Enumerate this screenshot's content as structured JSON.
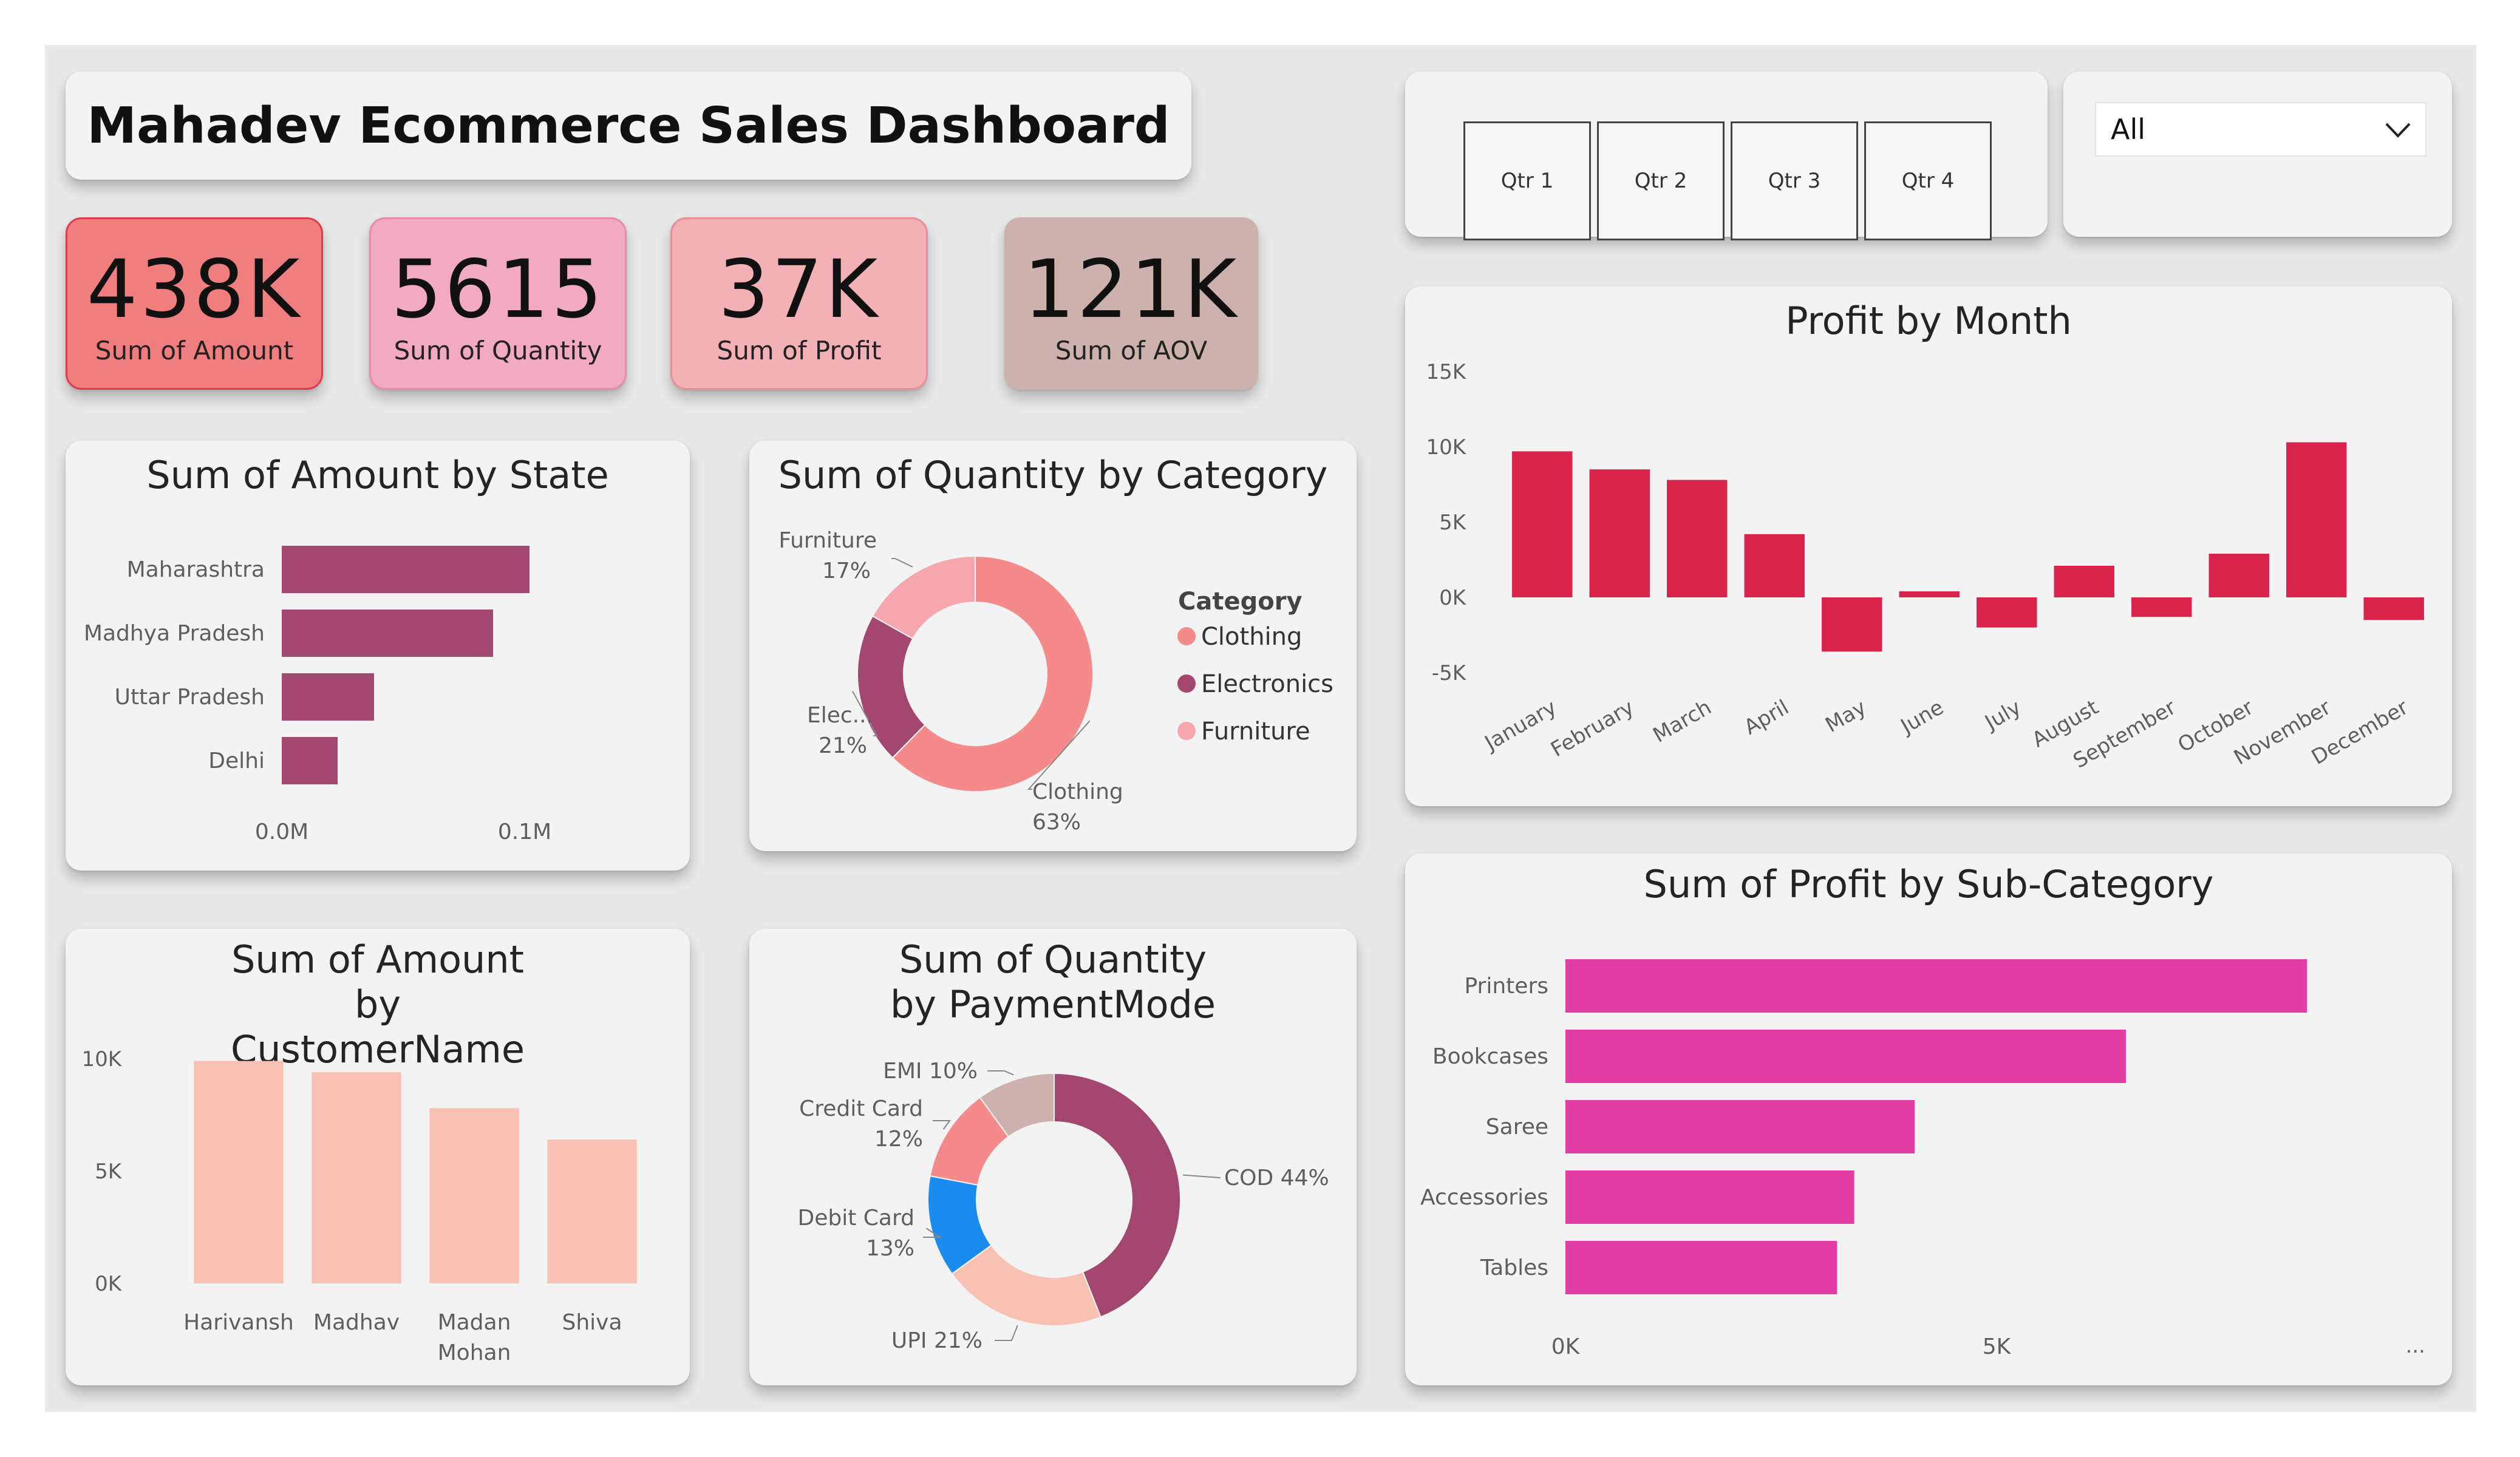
{
  "dashboard_title": "Mahadev Ecommerce Sales Dashboard",
  "kpis": [
    {
      "value": "438K",
      "label": "Sum of Amount",
      "color": "#f07e7e",
      "border": "#e03a4a"
    },
    {
      "value": "5615",
      "label": "Sum of Quantity",
      "color": "#f2a9c2",
      "border": "#e88aa8"
    },
    {
      "value": "37K",
      "label": "Sum of Profit",
      "color": "#f1b1b5",
      "border": "#ea8e95"
    },
    {
      "value": "121K",
      "label": "Sum of AOV",
      "color": "#ccb1ad",
      "border": "#ccb1ad"
    }
  ],
  "quarter_slicer": {
    "items": [
      "Qtr 1",
      "Qtr 2",
      "Qtr 3",
      "Qtr 4"
    ]
  },
  "dropdown_slicer": {
    "value": "All",
    "icon": "chevron-down-icon"
  },
  "chart_data": [
    {
      "id": "amount_by_state",
      "type": "bar",
      "orientation": "horizontal",
      "title": "Sum of Amount by State",
      "categories": [
        "Maharashtra",
        "Madhya Pradesh",
        "Uttar Pradesh",
        "Delhi"
      ],
      "values": [
        102000,
        87000,
        38000,
        23000
      ],
      "xticks": [
        "0.0M",
        "0.1M"
      ],
      "xtick_values": [
        0,
        100000
      ],
      "xlim": [
        0,
        140000
      ],
      "color": "#a3476f"
    },
    {
      "id": "quantity_by_category",
      "type": "pie",
      "style": "donut",
      "title": "Sum of Quantity by Category",
      "legend_title": "Category",
      "legend_position": "right",
      "labels": [
        "Clothing",
        "Electronics",
        "Furniture"
      ],
      "values": [
        63,
        21,
        17
      ],
      "slice_labels": [
        {
          "name": "Clothing",
          "pct": "63%"
        },
        {
          "name": "Elec...",
          "pct": "21%"
        },
        {
          "name": "Furniture",
          "pct": "17%"
        }
      ],
      "colors": [
        "#f58a8b",
        "#a3476f",
        "#f7a6ae"
      ]
    },
    {
      "id": "profit_by_month",
      "type": "bar",
      "title": "Profit by Month",
      "categories": [
        "January",
        "February",
        "March",
        "April",
        "May",
        "June",
        "July",
        "August",
        "September",
        "October",
        "November",
        "December"
      ],
      "values": [
        9700,
        8500,
        7800,
        4200,
        -3600,
        400,
        -2000,
        2100,
        -1300,
        2900,
        10300,
        -1500
      ],
      "yticks": [
        "15K",
        "10K",
        "5K",
        "0K",
        "-5K"
      ],
      "ytick_values": [
        15000,
        10000,
        5000,
        0,
        -5000
      ],
      "ylim": [
        -5000,
        15000
      ],
      "color": "#d9234a"
    },
    {
      "id": "amount_by_customer",
      "type": "bar",
      "title": "Sum of Amount by CustomerName",
      "categories": [
        "Harivansh",
        "Madhav",
        "Madan Mohan",
        "Shiva"
      ],
      "category_lines": [
        [
          "Harivansh"
        ],
        [
          "Madhav"
        ],
        [
          "Madan",
          "Mohan"
        ],
        [
          "Shiva"
        ]
      ],
      "values": [
        9900,
        9400,
        7800,
        6400
      ],
      "yticks": [
        "10K",
        "5K",
        "0K"
      ],
      "ytick_values": [
        10000,
        5000,
        0
      ],
      "ylim": [
        0,
        10000
      ],
      "color": "#f9c1b1"
    },
    {
      "id": "quantity_by_paymentmode",
      "type": "pie",
      "style": "donut",
      "title": "Sum of Quantity by PaymentMode",
      "labels": [
        "COD",
        "UPI",
        "Debit Card",
        "Credit Card",
        "EMI"
      ],
      "values": [
        44,
        21,
        13,
        12,
        10
      ],
      "slice_labels": [
        {
          "name": "COD 44%"
        },
        {
          "name": "UPI 21%"
        },
        {
          "name": "Debit Card",
          "pct": "13%"
        },
        {
          "name": "Credit Card",
          "pct": "12%"
        },
        {
          "name": "EMI 10%"
        }
      ],
      "colors": [
        "#a3476f",
        "#f9c1b1",
        "#1a8cf0",
        "#f58a8b",
        "#ccb1ad"
      ]
    },
    {
      "id": "profit_by_subcategory",
      "type": "bar",
      "orientation": "horizontal",
      "title": "Sum of Profit by Sub-Category",
      "categories": [
        "Printers",
        "Bookcases",
        "Saree",
        "Accessories",
        "Tables"
      ],
      "values": [
        8600,
        6500,
        4050,
        3350,
        3150
      ],
      "xticks": [
        "0K",
        "5K"
      ],
      "xtick_values": [
        0,
        5000
      ],
      "xlim": [
        0,
        10000
      ],
      "more_indicator": "...",
      "color": "#e23ea4"
    }
  ]
}
